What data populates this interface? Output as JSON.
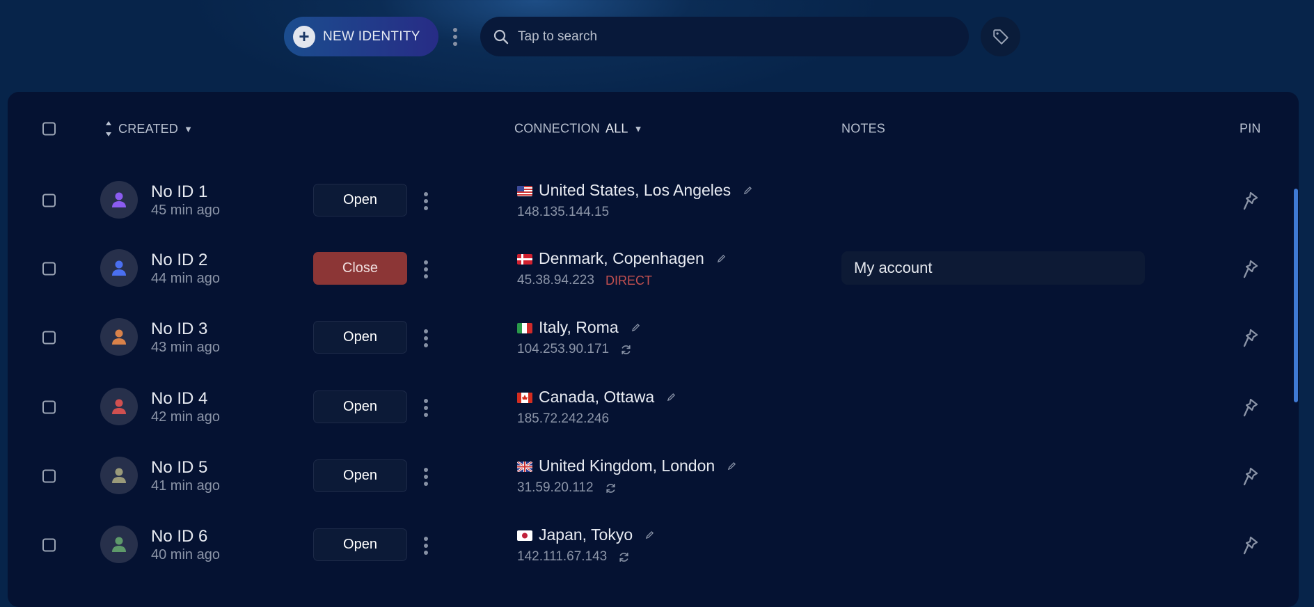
{
  "toolbar": {
    "new_identity": "NEW IDENTITY",
    "search_placeholder": "Tap to search"
  },
  "table": {
    "headers": {
      "created": "CREATED",
      "connection": "CONNECTION",
      "connection_filter": "ALL",
      "notes": "NOTES",
      "pin": "PIN"
    },
    "rows": [
      {
        "name": "No ID 1",
        "time": "45 min ago",
        "action": "Open",
        "avatar_color": "#8b5cf0",
        "flag": "us",
        "location": "United States, Los Angeles",
        "ip": "148.135.144.15",
        "status": "",
        "refresh": false,
        "note": ""
      },
      {
        "name": "No ID 2",
        "time": "44 min ago",
        "action": "Close",
        "avatar_color": "#4a6ff0",
        "flag": "dk",
        "location": "Denmark, Copenhagen",
        "ip": "45.38.94.223",
        "status": "DIRECT",
        "refresh": false,
        "note": "My account"
      },
      {
        "name": "No ID 3",
        "time": "43 min ago",
        "action": "Open",
        "avatar_color": "#d9824a",
        "flag": "it",
        "location": "Italy, Roma",
        "ip": "104.253.90.171",
        "status": "",
        "refresh": true,
        "note": ""
      },
      {
        "name": "No ID 4",
        "time": "42 min ago",
        "action": "Open",
        "avatar_color": "#d05050",
        "flag": "ca",
        "location": "Canada, Ottawa",
        "ip": "185.72.242.246",
        "status": "",
        "refresh": false,
        "note": ""
      },
      {
        "name": "No ID 5",
        "time": "41 min ago",
        "action": "Open",
        "avatar_color": "#9a9a7a",
        "flag": "gb",
        "location": "United Kingdom, London",
        "ip": "31.59.20.112",
        "status": "",
        "refresh": true,
        "note": ""
      },
      {
        "name": "No ID 6",
        "time": "40 min ago",
        "action": "Open",
        "avatar_color": "#5e9a6a",
        "flag": "jp",
        "location": "Japan, Tokyo",
        "ip": "142.111.67.143",
        "status": "",
        "refresh": true,
        "note": ""
      }
    ]
  }
}
